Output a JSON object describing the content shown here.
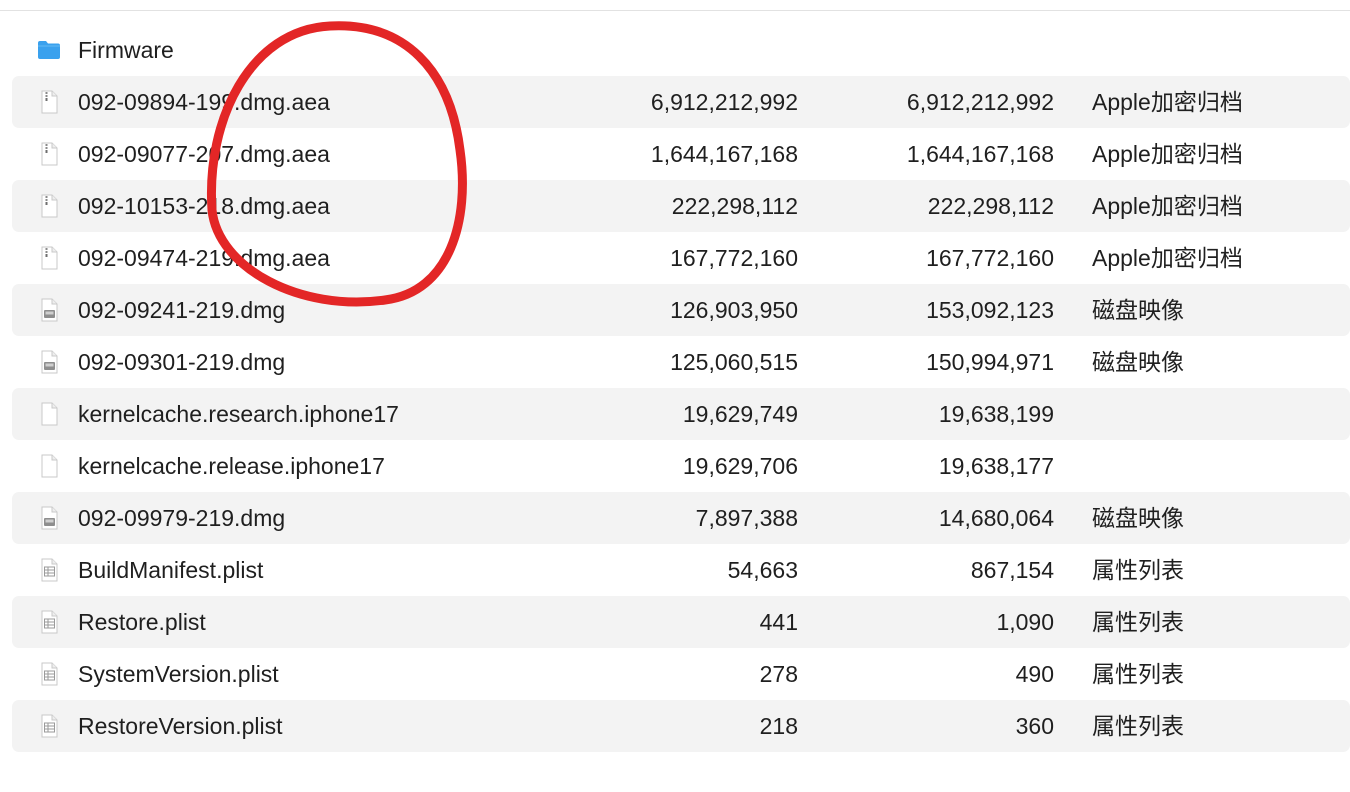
{
  "window": {
    "title": ""
  },
  "colors": {
    "folder": "#3aa1ee",
    "folder_tab": "#5cb6f3",
    "row_alt": "#f3f3f3",
    "annotation_stroke": "#e32626"
  },
  "columns": [
    "name",
    "compressed_size",
    "original_size",
    "kind"
  ],
  "rows": [
    {
      "name": "Firmware",
      "size": "",
      "orig": "",
      "kind": "",
      "icon": "folder-icon"
    },
    {
      "name": "092-09894-199.dmg.aea",
      "size": "6,912,212,992",
      "orig": "6,912,212,992",
      "kind": "Apple加密归档",
      "icon": "archive-file-icon"
    },
    {
      "name": "092-09077-207.dmg.aea",
      "size": "1,644,167,168",
      "orig": "1,644,167,168",
      "kind": "Apple加密归档",
      "icon": "archive-file-icon"
    },
    {
      "name": "092-10153-218.dmg.aea",
      "size": "222,298,112",
      "orig": "222,298,112",
      "kind": "Apple加密归档",
      "icon": "archive-file-icon"
    },
    {
      "name": "092-09474-219.dmg.aea",
      "size": "167,772,160",
      "orig": "167,772,160",
      "kind": "Apple加密归档",
      "icon": "archive-file-icon"
    },
    {
      "name": "092-09241-219.dmg",
      "size": "126,903,950",
      "orig": "153,092,123",
      "kind": "磁盘映像",
      "icon": "disk-image-icon"
    },
    {
      "name": "092-09301-219.dmg",
      "size": "125,060,515",
      "orig": "150,994,971",
      "kind": "磁盘映像",
      "icon": "disk-image-icon"
    },
    {
      "name": "kernelcache.research.iphone17",
      "size": "19,629,749",
      "orig": "19,638,199",
      "kind": "",
      "icon": "document-icon"
    },
    {
      "name": "kernelcache.release.iphone17",
      "size": "19,629,706",
      "orig": "19,638,177",
      "kind": "",
      "icon": "document-icon"
    },
    {
      "name": "092-09979-219.dmg",
      "size": "7,897,388",
      "orig": "14,680,064",
      "kind": "磁盘映像",
      "icon": "disk-image-icon"
    },
    {
      "name": "BuildManifest.plist",
      "size": "54,663",
      "orig": "867,154",
      "kind": "属性列表",
      "icon": "plist-icon"
    },
    {
      "name": "Restore.plist",
      "size": "441",
      "orig": "1,090",
      "kind": "属性列表",
      "icon": "plist-icon"
    },
    {
      "name": "SystemVersion.plist",
      "size": "278",
      "orig": "490",
      "kind": "属性列表",
      "icon": "plist-icon"
    },
    {
      "name": "RestoreVersion.plist",
      "size": "218",
      "orig": "360",
      "kind": "属性列表",
      "icon": "plist-icon"
    }
  ]
}
